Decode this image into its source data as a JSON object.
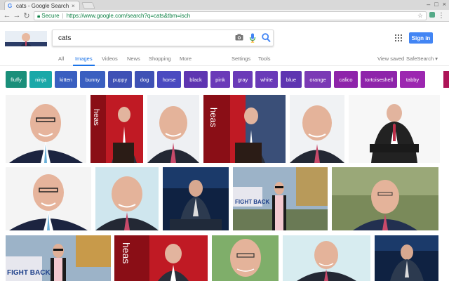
{
  "browser": {
    "tab_title": "cats - Google Search",
    "tab_favicon": "G",
    "tab_close": "×",
    "secure_label": "Secure",
    "url": "https://www.google.com/search?q=cats&tbm=isch",
    "window_controls": [
      "–",
      "□",
      "×"
    ]
  },
  "search": {
    "query": "cats",
    "sign_in_label": "Sign in"
  },
  "nav": {
    "tabs": [
      "All",
      "Images",
      "Videos",
      "News",
      "Shopping",
      "More"
    ],
    "active": "Images",
    "tools": [
      "Settings",
      "Tools"
    ],
    "view_saved": "View saved",
    "safesearch": "SafeSearch ▾"
  },
  "chips": [
    {
      "label": "fluffy",
      "color": "#1a8f7a"
    },
    {
      "label": "ninja",
      "color": "#1aa8a8"
    },
    {
      "label": "kitten",
      "color": "#3a5fc0"
    },
    {
      "label": "bunny",
      "color": "#3a5fc0"
    },
    {
      "label": "puppy",
      "color": "#3f51b5"
    },
    {
      "label": "dog",
      "color": "#3f51b5"
    },
    {
      "label": "horse",
      "color": "#4a4ac0"
    },
    {
      "label": "black",
      "color": "#5e35b1"
    },
    {
      "label": "pink",
      "color": "#6a3ab8"
    },
    {
      "label": "gray",
      "color": "#6a3ab8"
    },
    {
      "label": "white",
      "color": "#6a3ab8"
    },
    {
      "label": "blue",
      "color": "#5e35b1"
    },
    {
      "label": "orange",
      "color": "#7b3ab5"
    },
    {
      "label": "calico",
      "color": "#8e24aa"
    },
    {
      "label": "tortoiseshell",
      "color": "#8e24aa"
    },
    {
      "label": "tabby",
      "color": "#9c27b0"
    }
  ],
  "icons": {
    "camera": "camera-icon",
    "mic": "microphone-icon",
    "search": "search-icon",
    "apps": "apps-grid-icon",
    "back": "back-arrow-icon",
    "forward": "forward-arrow-icon",
    "reload": "reload-icon",
    "star": "bookmark-star-icon",
    "menu": "menu-dots-icon"
  },
  "images": [
    {
      "kind": "man-smile-blue",
      "row": 1
    },
    {
      "kind": "red-banner-podium",
      "row": 1
    },
    {
      "kind": "man-face-pink-tie",
      "row": 1
    },
    {
      "kind": "red-banner-podium",
      "row": 1
    },
    {
      "kind": "man-face-pink-tie",
      "row": 1
    },
    {
      "kind": "man-seated-suit",
      "row": 1
    },
    {
      "kind": "man-smile-blue",
      "row": 2
    },
    {
      "kind": "man-face-pink-tie",
      "row": 2
    },
    {
      "kind": "man-seated-dark",
      "row": 2
    },
    {
      "kind": "man-outdoor-fightback",
      "row": 2
    },
    {
      "kind": "man-outdoor-portrait",
      "row": 2
    },
    {
      "kind": "man-outdoor-fightback",
      "row": 3
    },
    {
      "kind": "red-banner-podium",
      "row": 3
    },
    {
      "kind": "man-face-green",
      "row": 3
    },
    {
      "kind": "man-face-pink-tie",
      "row": 3
    },
    {
      "kind": "man-seated-dark",
      "row": 3
    }
  ],
  "text_in_images": {
    "banner": "heas",
    "fightback": "FIGHT BACK"
  }
}
